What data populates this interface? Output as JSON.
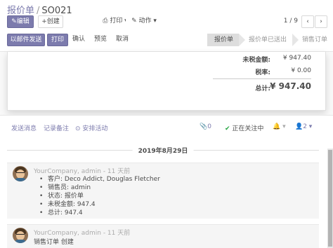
{
  "breadcrumb": {
    "parent": "报价单",
    "separator": "/",
    "current": "SO021"
  },
  "toolbar": {
    "edit_label": "✎编辑",
    "create_label": "+创建",
    "print_label": "⎙ 打印 ▾",
    "action_label": "✎ 动作 ▾",
    "pager_text": "1 / 9",
    "pager_prev": "‹",
    "pager_next": "›"
  },
  "header_buttons": {
    "send_email": "以邮件发送",
    "print": "打印",
    "confirm": "确认",
    "preview": "预览",
    "cancel": "取消"
  },
  "statusbar": {
    "stages": [
      {
        "label": "报价单",
        "active": true
      },
      {
        "label": "报价单已送出",
        "active": false
      },
      {
        "label": "销售订单",
        "active": false
      }
    ]
  },
  "totals": {
    "untaxed_label": "未税金额:",
    "untaxed_value": "¥ 947.40",
    "tax_label": "税率:",
    "tax_value": "¥ 0.00",
    "total_label": "总计:",
    "total_value": "¥ 947.40"
  },
  "chatter": {
    "send_message": "发送消息",
    "log_note": "记录备注",
    "schedule_activity": "⊙ 安排活动",
    "attachments": "📎0",
    "following": "正在关注中",
    "following_check": "✔",
    "follow_dropdown": "🔔 ▾",
    "followers": "👤2 ▾",
    "date_separator": "2019年8月29日",
    "messages": [
      {
        "author": "YourCompany, admin",
        "time": " - 11 天前",
        "tracking": [
          "客户: Deco Addict, Douglas Fletcher",
          "销售员: admin",
          "状态: 报价单",
          "未税金额: 947.4",
          "总计: 947.4"
        ]
      },
      {
        "author": "YourCompany, admin",
        "time": " - 11 天前",
        "body": "销售订单 创建"
      }
    ]
  },
  "colors": {
    "accent": "#7c7bad",
    "stage_active": "#dddddd",
    "follow_check": "#28a745"
  }
}
